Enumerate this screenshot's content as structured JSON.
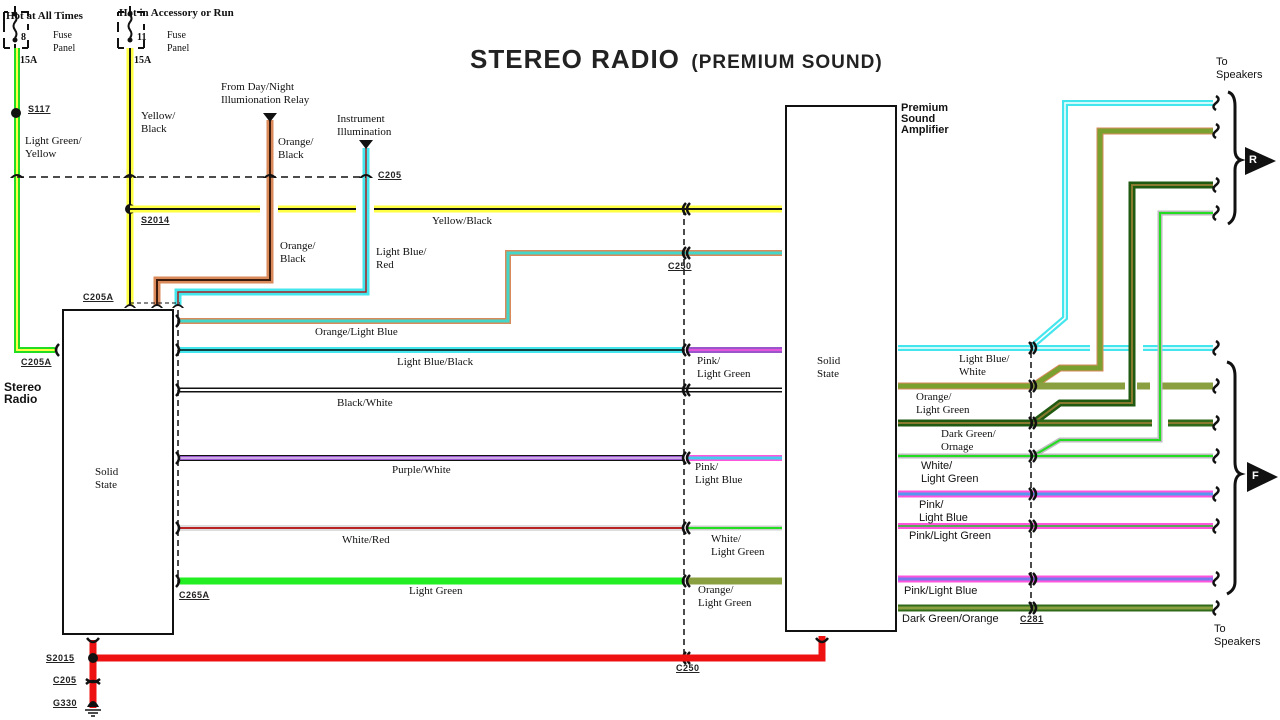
{
  "title": {
    "main": "STEREO RADIO",
    "sub": "(PREMIUM SOUND)"
  },
  "power": {
    "hot_all_times": {
      "label": "Hot at All Times",
      "fuse_number": "8",
      "fuse_rating": "15A",
      "fuse_panel": "Fuse\nPanel"
    },
    "hot_acc_run": {
      "label": "Hot in Accessory or Run",
      "fuse_number": "11",
      "fuse_rating": "15A",
      "fuse_panel": "Fuse\nPanel"
    },
    "day_night": "From Day/Night\nIllumionation Relay",
    "instrument": "Instrument\nIllumination"
  },
  "modules": {
    "stereo_radio": {
      "name": "Stereo\nRadio",
      "inner": "Solid\nState"
    },
    "amplifier": {
      "name": "Premium\nSound\nAmplifier",
      "inner": "Solid\nState"
    }
  },
  "connectors": {
    "s117": "S117",
    "s2014": "S2014",
    "c205": "C205",
    "c205a_top": "C205A",
    "c205a_left": "C205A",
    "c265a": "C265A",
    "c250_top": "C250",
    "c250_bottom": "C250",
    "c281": "C281",
    "s2015": "S2015",
    "c205_ground": "C205",
    "g330": "G330"
  },
  "wires": {
    "light_green_yellow": "Light Green/\nYellow",
    "yellow_black_vertical": "Yellow/\nBlack",
    "orange_black_top": "Orange/\nBlack",
    "orange_black_lower": "Orange/\nBlack",
    "light_blue_red": "Light Blue/\nRed",
    "yellow_black_horizontal": "Yellow/Black",
    "orange_light_blue": "Orange/Light Blue",
    "light_blue_black": "Light Blue/Black",
    "black_white": "Black/White",
    "purple_white": "Purple/White",
    "white_red": "White/Red",
    "light_green": "Light Green",
    "amp_in_pink_light_green": "Pink/\nLight Green",
    "amp_in_pink_light_blue": "Pink/\nLight Blue",
    "amp_in_white_light_green": "White/\nLight Green",
    "amp_in_orange_light_green": "Orange/\nLight Green",
    "out_light_blue_white": "Light Blue/\nWhite",
    "out_orange_light_green": "Orange/\nLight Green",
    "out_dark_green_orange": "Dark Green/\nOrnage",
    "out_white_light_green": "White/\nLight Green",
    "out_pink_light_blue": "Pink/\nLight Blue",
    "out_pink_light_green": "Pink/Light Green",
    "out_pink_light_blue_2": "Pink/Light Blue",
    "out_dark_green_orange_2": "Dark Green/Orange"
  },
  "speakers": {
    "to_speakers_top": "To\nSpeakers",
    "to_speakers_bottom": "To\nSpeakers",
    "rear_badge": "R",
    "front_badge": "F"
  },
  "colors": {
    "light_green": "#22dd22",
    "yellow": "#ffff44",
    "orange": "#d9895a",
    "light_blue": "#44e6ee",
    "purple": "#9955cc",
    "pink": "#ff55dd",
    "red": "#ee1111",
    "olive_green": "#7aa030",
    "dark_green": "#2f6a1a",
    "black": "#111111"
  }
}
